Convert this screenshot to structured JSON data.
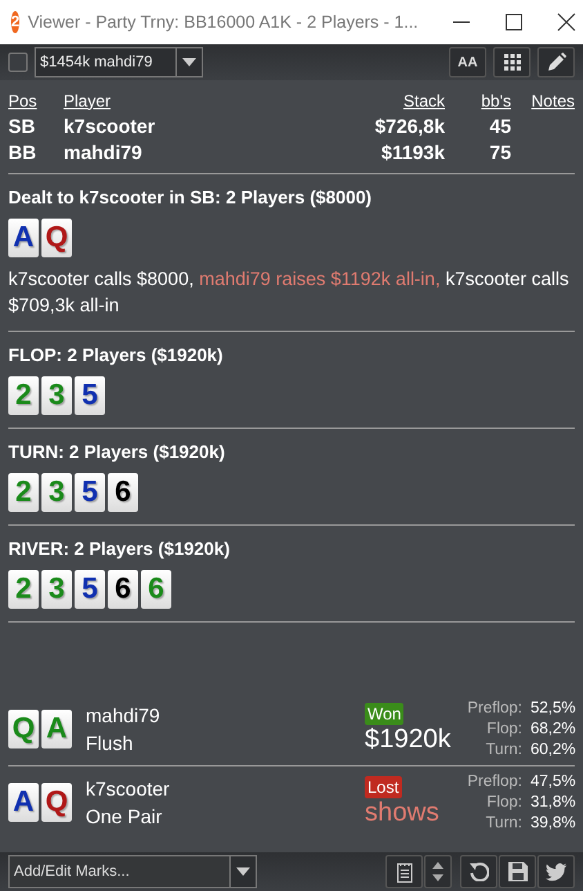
{
  "window": {
    "badge": "2",
    "title": "Viewer - Party Trny: BB16000 A1K - 2 Players - 1..."
  },
  "toolbar": {
    "checked": false,
    "selector": "$1454k mahdi79",
    "font_button": "AA"
  },
  "table": {
    "columns": [
      "Pos",
      "Player",
      "Stack",
      "bb's",
      "Notes"
    ],
    "rows": [
      {
        "pos": "SB",
        "player": "k7scooter",
        "stack": "$726,8k",
        "bbs": "45"
      },
      {
        "pos": "BB",
        "player": "mahdi79",
        "stack": "$1193k",
        "bbs": "75"
      }
    ]
  },
  "streets": [
    {
      "title": "Dealt to k7scooter in SB: 2 Players ($8000)",
      "cards": [
        {
          "rank": "A",
          "color": "#1030b0"
        },
        {
          "rank": "Q",
          "color": "#b01818"
        }
      ],
      "actions": [
        {
          "kind": "normal",
          "text": "k7scooter calls $8000,"
        },
        {
          "kind": "aggressive",
          "text": "mahdi79 raises $1192k all-in,"
        },
        {
          "kind": "normal",
          "text": "k7scooter calls $709,3k all-in"
        }
      ]
    },
    {
      "title": "FLOP: 2 Players ($1920k)",
      "cards": [
        {
          "rank": "2",
          "color": "#1a8a1a"
        },
        {
          "rank": "3",
          "color": "#1a8a1a"
        },
        {
          "rank": "5",
          "color": "#1030b0"
        }
      ]
    },
    {
      "title": "TURN: 2 Players ($1920k)",
      "cards": [
        {
          "rank": "2",
          "color": "#1a8a1a"
        },
        {
          "rank": "3",
          "color": "#1a8a1a"
        },
        {
          "rank": "5",
          "color": "#1030b0"
        },
        {
          "rank": "6",
          "color": "#000000"
        }
      ]
    },
    {
      "title": "RIVER: 2 Players ($1920k)",
      "cards": [
        {
          "rank": "2",
          "color": "#1a8a1a"
        },
        {
          "rank": "3",
          "color": "#1a8a1a"
        },
        {
          "rank": "5",
          "color": "#1030b0"
        },
        {
          "rank": "6",
          "color": "#000000"
        },
        {
          "rank": "6",
          "color": "#1a8a1a"
        }
      ]
    }
  ],
  "results": [
    {
      "cards": [
        {
          "rank": "Q",
          "color": "#1a8a1a"
        },
        {
          "rank": "A",
          "color": "#1a8a1a"
        }
      ],
      "player": "mahdi79",
      "hand": "Flush",
      "kind": "win",
      "badge": "Won",
      "amount": "$1920k",
      "equity": [
        {
          "label": "Preflop:",
          "value": "52,5%"
        },
        {
          "label": "Flop:",
          "value": "68,2%"
        },
        {
          "label": "Turn:",
          "value": "60,2%"
        }
      ]
    },
    {
      "cards": [
        {
          "rank": "A",
          "color": "#1030b0"
        },
        {
          "rank": "Q",
          "color": "#b01818"
        }
      ],
      "player": "k7scooter",
      "hand": "One Pair",
      "kind": "loss",
      "badge": "Lost",
      "amount": "shows",
      "equity": [
        {
          "label": "Preflop:",
          "value": "47,5%"
        },
        {
          "label": "Flop:",
          "value": "31,8%"
        },
        {
          "label": "Turn:",
          "value": "39,8%"
        }
      ]
    }
  ],
  "bottom_bar": {
    "marks_placeholder": "Add/Edit Marks..."
  }
}
